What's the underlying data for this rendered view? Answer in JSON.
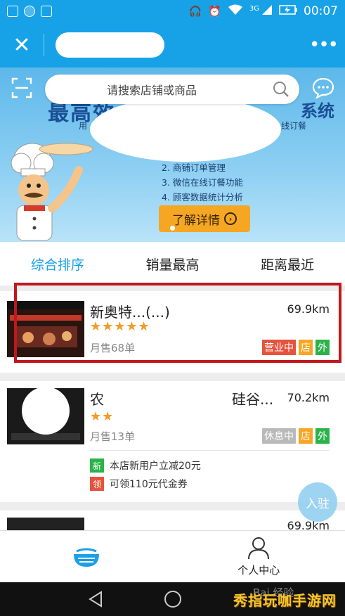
{
  "status_bar": {
    "time": "00:07",
    "network": "3G",
    "icons": [
      "notification-icon",
      "qq-icon",
      "gallery-icon",
      "headphone-icon",
      "alarm-icon",
      "wifi-icon",
      "signal-icon",
      "battery-icon"
    ]
  },
  "title_bar": {
    "close_label": "✕",
    "more_label": "•••"
  },
  "search": {
    "placeholder": "请搜索店铺或商品"
  },
  "banner": {
    "headline": "最高效",
    "headline_suffix": "系统",
    "sub_left": "用",
    "sub_right": "线订餐",
    "features": [
      "2. 商铺订单管理",
      "3. 微信在线订餐功能",
      "4. 顾客数据统计分析"
    ],
    "detail_button": "了解详情"
  },
  "sort_tabs": [
    {
      "label": "综合排序",
      "active": true
    },
    {
      "label": "销量最高",
      "active": false
    },
    {
      "label": "距离最近",
      "active": false
    }
  ],
  "shops": [
    {
      "name": "新奥特...(...)",
      "distance": "69.9km",
      "stars": "★★★★★",
      "sales": "月售68单",
      "tags": [
        {
          "label": "营业中",
          "color": "#e5533d"
        },
        {
          "label": "店",
          "color": "#f5a623"
        },
        {
          "label": "外",
          "color": "#2ab34a"
        }
      ]
    },
    {
      "name": "农",
      "name_tail": "硅谷...",
      "distance": "70.2km",
      "stars": "★★",
      "sales": "月售13单",
      "tags": [
        {
          "label": "休息中",
          "color": "#b9b9b9"
        },
        {
          "label": "店",
          "color": "#f5a623"
        },
        {
          "label": "外",
          "color": "#2ab34a"
        }
      ],
      "promos": [
        {
          "badge": "新",
          "text": "本店新用户立减20元",
          "color": "#2ab34a"
        },
        {
          "badge": "领",
          "text": "可领110元代金券",
          "color": "#e5533d"
        }
      ]
    },
    {
      "distance": "69.9km"
    }
  ],
  "enter_button": "入驻",
  "bottom_nav": {
    "home_icon": "bowl-icon",
    "profile_label": "个人中心"
  },
  "watermark": "秀指玩咖手游网",
  "watermark2": "Bai 经验"
}
